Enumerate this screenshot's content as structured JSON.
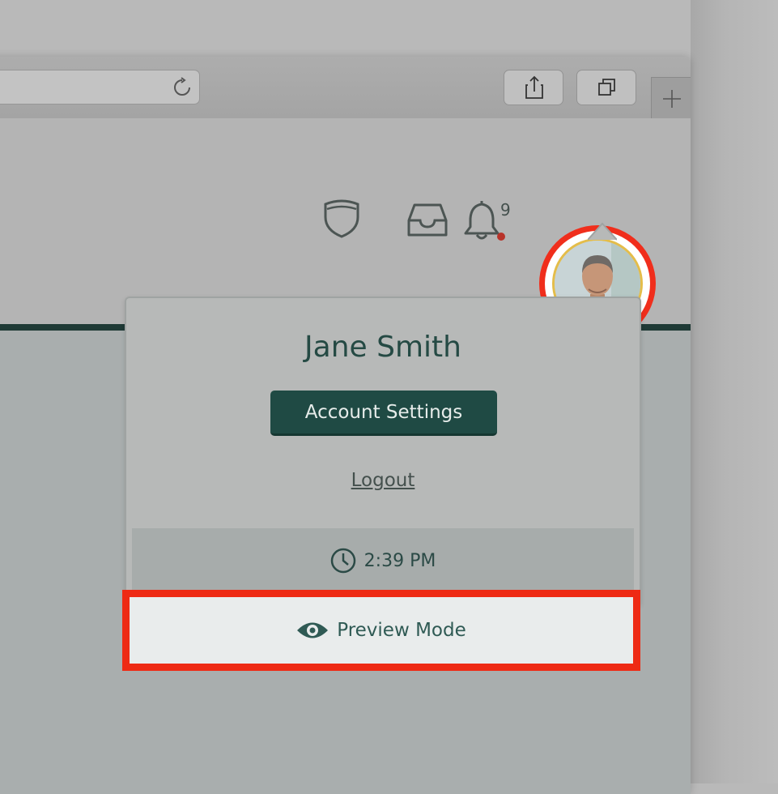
{
  "browser": {
    "toolbar": {
      "share_icon": "share-icon",
      "tabs_icon": "tabs-overview-icon",
      "new_tab_icon": "plus-icon",
      "reload_icon": "reload-icon"
    }
  },
  "header": {
    "icons": [
      "shield-icon",
      "inbox-icon",
      "bell-icon"
    ],
    "notification_count": "9",
    "notification_dot_color": "#b8332a",
    "highlight_color": "#f02e1c",
    "avatar_border_color": "#e4bd4a"
  },
  "profile_menu": {
    "user_name": "Jane Smith",
    "account_settings_label": "Account Settings",
    "logout_label": "Logout",
    "time": "2:39 PM",
    "preview_mode_label": "Preview Mode",
    "accent_color": "#1f4a44"
  }
}
